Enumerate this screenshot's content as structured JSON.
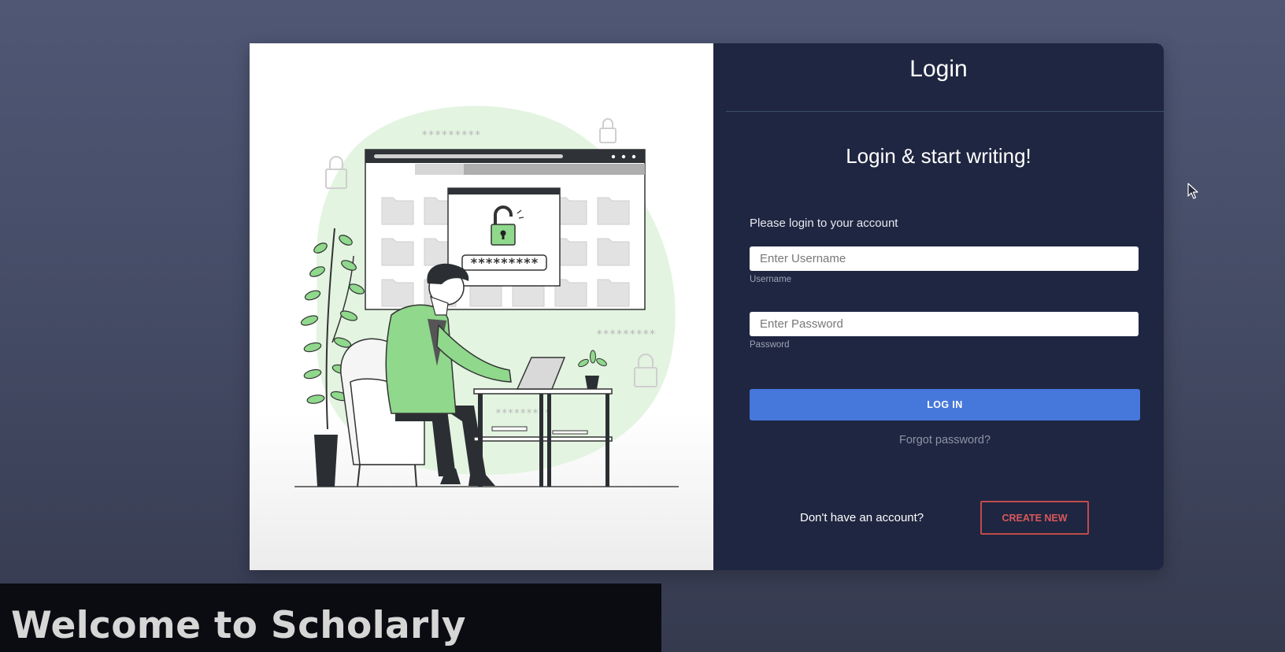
{
  "login_panel": {
    "title": "Login",
    "subtitle": "Login & start writing!",
    "prompt": "Please login to your account",
    "username": {
      "placeholder": "Enter Username",
      "value": "",
      "caption": "Username"
    },
    "password": {
      "placeholder": "Enter Password",
      "value": "",
      "caption": "Password"
    },
    "login_button": "LOG IN",
    "forgot_link": "Forgot password?",
    "signup_prompt": "Don't have an account?",
    "create_button": "CREATE NEW"
  },
  "illustration": {
    "masked_text_top": "*********",
    "masked_text_field": "*********",
    "masked_text_right": "*********",
    "masked_text_table": "*********"
  },
  "caption": {
    "text": "Welcome to Scholarly"
  },
  "colors": {
    "page_background": "#4f5775",
    "form_panel": "#1f2641",
    "login_button": "#4677db",
    "create_button_border": "#bf4b4b",
    "illustration_accent": "#8fd88c"
  },
  "icons": [
    "padlock-icon",
    "folder-icon",
    "mouse-cursor-icon"
  ]
}
